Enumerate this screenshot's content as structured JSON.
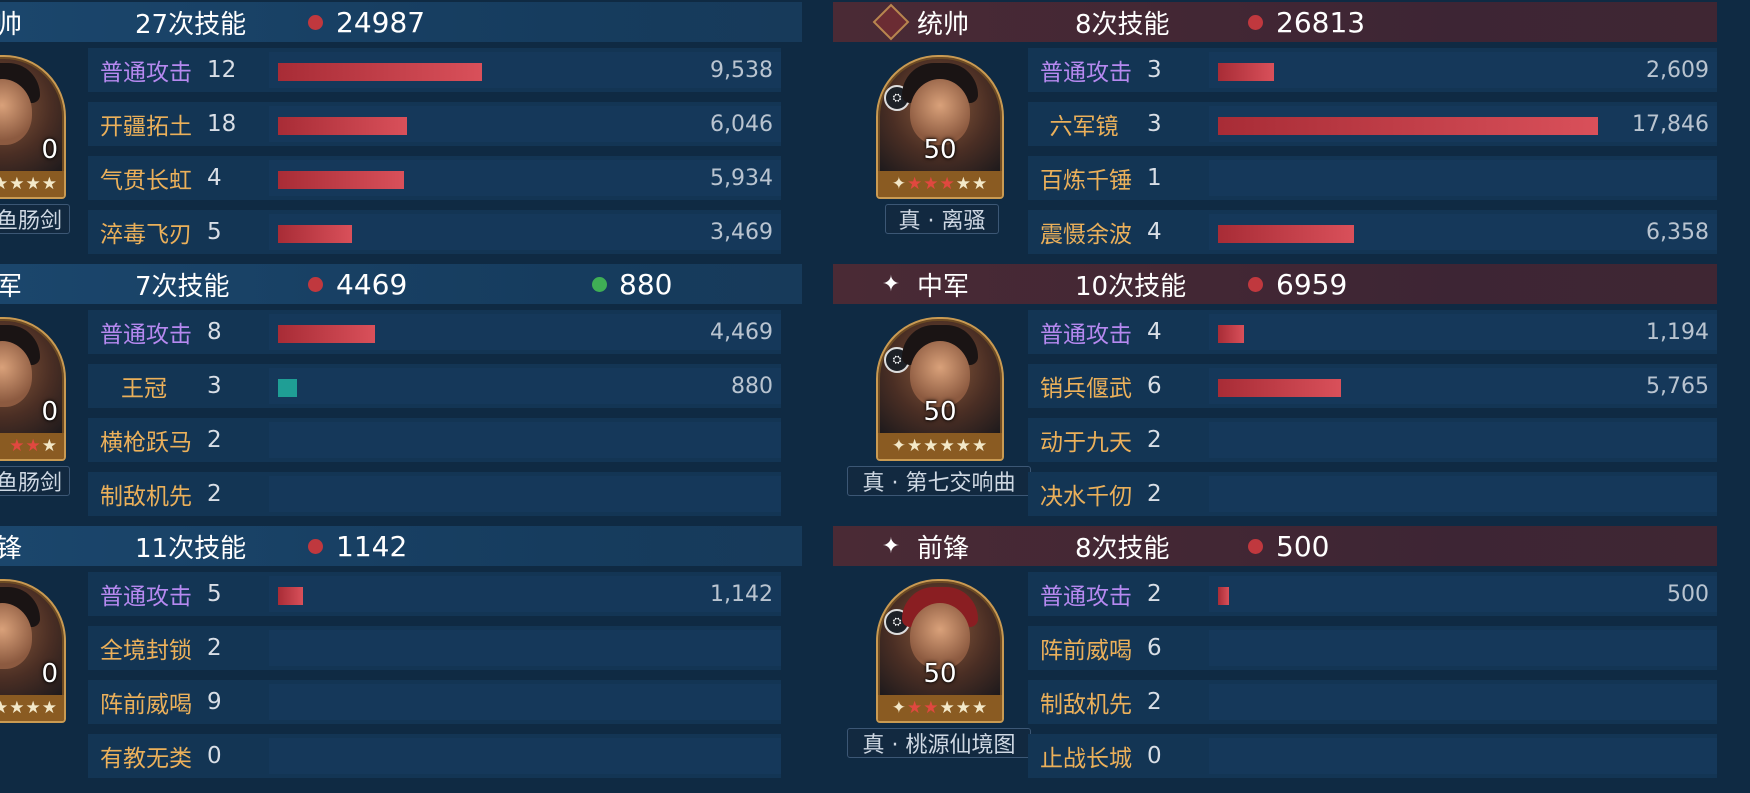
{
  "left_team": {
    "units": [
      {
        "role_label": "帅",
        "casts": "27次技能",
        "damage_total": "24987",
        "level": "0",
        "treasure": "鱼肠剑",
        "skills": [
          {
            "name": "普通攻击",
            "count": "12",
            "value": "9,538",
            "type": "normal"
          },
          {
            "name": "开疆拓土",
            "count": "18",
            "value": "6,046"
          },
          {
            "name": "气贯长虹",
            "count": "4",
            "value": "5,934"
          },
          {
            "name": "淬毒飞刃",
            "count": "5",
            "value": "3,469"
          }
        ]
      },
      {
        "role_label": "军",
        "casts": "7次技能",
        "damage_total": "4469",
        "heal_total": "880",
        "level": "0",
        "treasure": "鱼肠剑",
        "skills": [
          {
            "name": "普通攻击",
            "count": "8",
            "value": "4,469",
            "type": "normal"
          },
          {
            "name": "王冠",
            "count": "3",
            "value": "880"
          },
          {
            "name": "横枪跃马",
            "count": "2",
            "value": ""
          },
          {
            "name": "制敌机先",
            "count": "2",
            "value": ""
          }
        ]
      },
      {
        "role_label": "锋",
        "casts": "11次技能",
        "damage_total": "1142",
        "level": "0",
        "skills": [
          {
            "name": "普通攻击",
            "count": "5",
            "value": "1,142",
            "type": "normal"
          },
          {
            "name": "全境封锁",
            "count": "2",
            "value": ""
          },
          {
            "name": "阵前威喝",
            "count": "9",
            "value": ""
          },
          {
            "name": "有教无类",
            "count": "0",
            "value": ""
          }
        ]
      }
    ]
  },
  "right_team": {
    "units": [
      {
        "role_label": "统帅",
        "casts": "8次技能",
        "damage_total": "26813",
        "level": "50",
        "treasure": "真 · 离骚",
        "skills": [
          {
            "name": "普通攻击",
            "count": "3",
            "value": "2,609",
            "type": "normal"
          },
          {
            "name": "六军镜",
            "count": "3",
            "value": "17,846"
          },
          {
            "name": "百炼千锤",
            "count": "1",
            "value": ""
          },
          {
            "name": "震慑余波",
            "count": "4",
            "value": "6,358"
          }
        ]
      },
      {
        "role_label": "中军",
        "casts": "10次技能",
        "damage_total": "6959",
        "level": "50",
        "treasure": "真 · 第七交响曲",
        "skills": [
          {
            "name": "普通攻击",
            "count": "4",
            "value": "1,194",
            "type": "normal"
          },
          {
            "name": "销兵偃武",
            "count": "6",
            "value": "5,765"
          },
          {
            "name": "动于九天",
            "count": "2",
            "value": ""
          },
          {
            "name": "决水千仞",
            "count": "2",
            "value": ""
          }
        ]
      },
      {
        "role_label": "前锋",
        "casts": "8次技能",
        "damage_total": "500",
        "level": "50",
        "treasure": "真 · 桃源仙境图",
        "skills": [
          {
            "name": "普通攻击",
            "count": "2",
            "value": "500",
            "type": "normal"
          },
          {
            "name": "阵前威喝",
            "count": "6",
            "value": ""
          },
          {
            "name": "制敌机先",
            "count": "2",
            "value": ""
          },
          {
            "name": "止战长城",
            "count": "0",
            "value": ""
          }
        ]
      }
    ]
  },
  "colors": {
    "background": "#0f2a43",
    "damage_bar": "#c0383e",
    "heal_bar": "#1f9e95",
    "normal_attack_text": "#b689f0",
    "skill_text": "#ebb05a"
  }
}
